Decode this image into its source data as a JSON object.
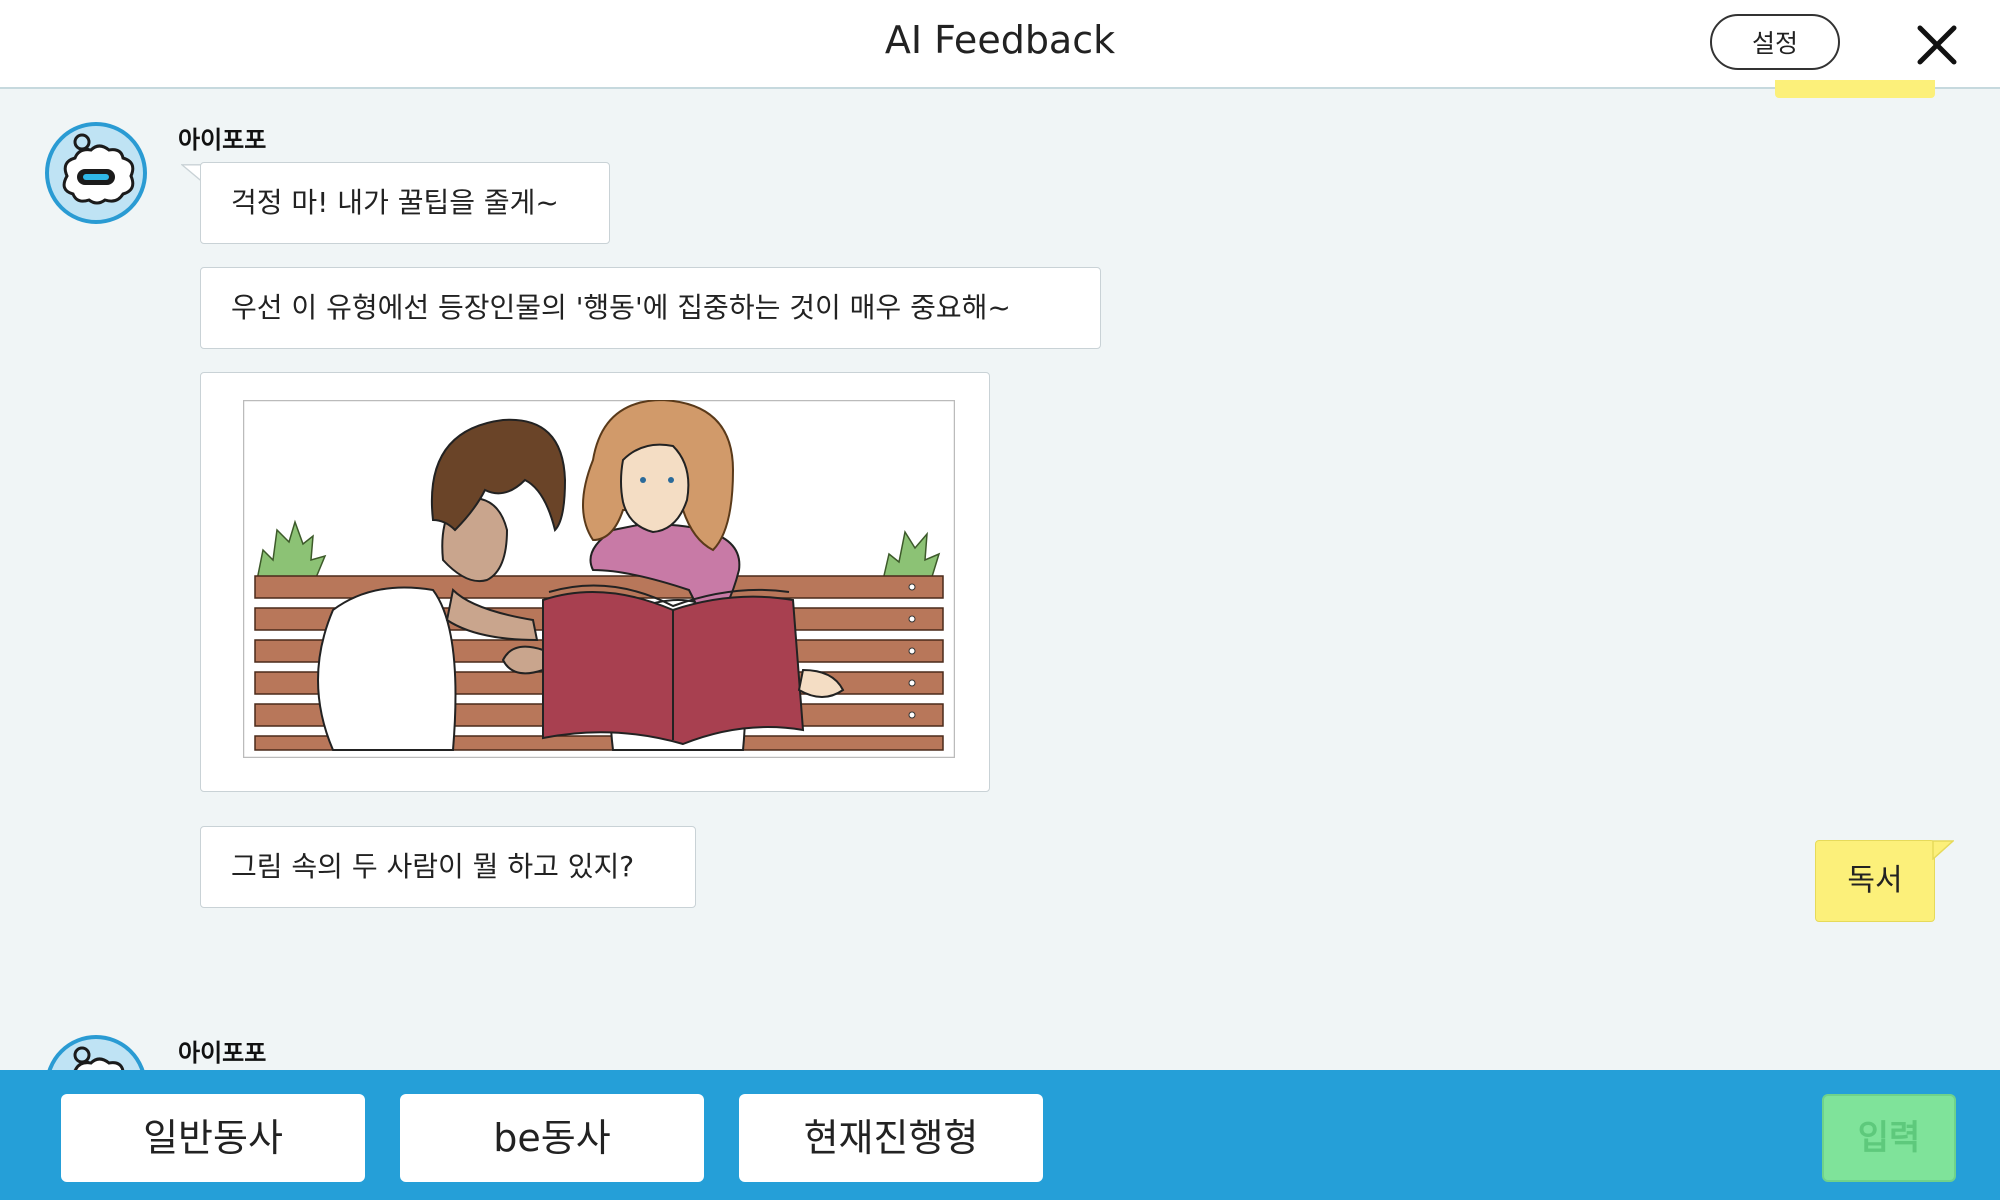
{
  "header": {
    "title": "AI Feedback",
    "settings_label": "설정",
    "close_icon": "close-icon"
  },
  "messages": {
    "bot_name_1": "아이포포",
    "bubble_1": "걱정 마! 내가 꿀팁을 줄게~",
    "bubble_2": "우선 이 유형에선 등장인물의 '행동'에 집중하는 것이 매우 중요해~",
    "image_icon": "illustration-two-people-reading-book",
    "bubble_3": "그림 속의 두 사람이 뭘 하고 있지?",
    "user_reply": "독서",
    "bot_name_2": "아이포포"
  },
  "footer": {
    "options": [
      "일반동사",
      "be동사",
      "현재진행형"
    ],
    "submit_label": "입력"
  },
  "colors": {
    "accent_blue": "#259fd8",
    "user_bubble": "#fcf07a",
    "submit_green": "#7fe39a",
    "chat_bg": "#f0f5f6"
  }
}
